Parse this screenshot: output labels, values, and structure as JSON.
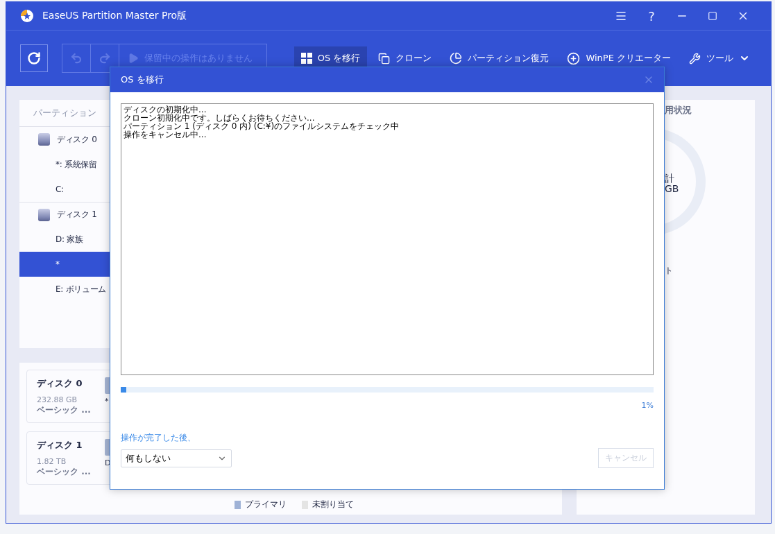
{
  "window": {
    "title": "EaseUS Partition Master Pro版",
    "help": "?"
  },
  "toolbar": {
    "pending": "保留中の操作はありません",
    "actions": [
      {
        "kind": "migrate",
        "label": "OS を移行",
        "selected": true
      },
      {
        "kind": "clone",
        "label": "クローン",
        "selected": false
      },
      {
        "kind": "recover",
        "label": "パーティション復元",
        "selected": false
      },
      {
        "kind": "winpe",
        "label": "WinPE クリエーター",
        "selected": false
      },
      {
        "kind": "tools",
        "label": "ツール",
        "selected": false
      }
    ]
  },
  "partitions": {
    "header": "パーティション",
    "disks": [
      {
        "name": "ディスク 0",
        "items": [
          {
            "label": "*: 系統保留",
            "selected": false
          },
          {
            "label": "C:",
            "selected": false
          }
        ]
      },
      {
        "name": "ディスク 1",
        "items": [
          {
            "label": "D: 家族",
            "selected": false
          },
          {
            "label": "*",
            "selected": true
          },
          {
            "label": "E: ボリューム",
            "selected": false
          }
        ]
      }
    ]
  },
  "disk_cards": [
    {
      "name": "ディスク 0",
      "size": "232.88 GB",
      "type": "ベーシック ...",
      "partition_label": "*"
    },
    {
      "name": "ディスク 1",
      "size": "1.82 TB",
      "type": "ベーシック ...",
      "partition_label": "D"
    }
  ],
  "legend": [
    {
      "label": "プライマリ",
      "color": "#9fb2d6"
    },
    {
      "label": "未割り当て",
      "color": "#e4e4e4"
    }
  ],
  "usage": {
    "title": "用状況",
    "total_label": "計",
    "total_value": "GB",
    "note": "ト"
  },
  "dialog": {
    "title": "OS を移行",
    "log": [
      "ディスクの初期化中...",
      "クローン初期化中です。しばらくお待ちください...",
      "パーティション 1 (ディスク 0 内) (C:¥)のファイルシステムをチェック中",
      "操作をキャンセル中..."
    ],
    "progress": {
      "level": 0.01,
      "reading": "1%"
    },
    "after_label": "操作が完了した後、",
    "after_value": "何もしない",
    "cancel": {
      "label": "キャンセル",
      "disabled": true
    }
  }
}
